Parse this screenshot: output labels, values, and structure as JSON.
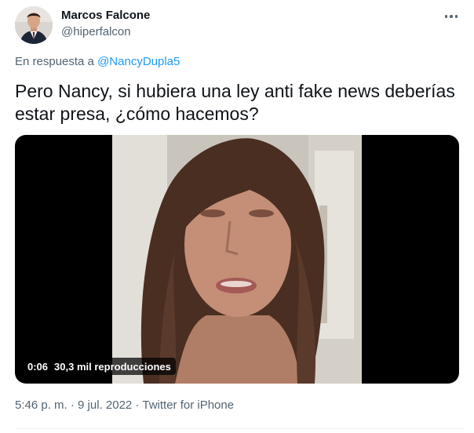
{
  "author": {
    "name": "Marcos Falcone",
    "handle": "@hiperfalcon"
  },
  "reply": {
    "prefix": "En respuesta a",
    "mention": "@NancyDupla5"
  },
  "tweet": {
    "text": "Pero Nancy, si hubiera una ley anti fake news deberías estar presa, ¿cómo hacemos?"
  },
  "video": {
    "duration": "0:06",
    "views": "30,3 mil reproducciones"
  },
  "meta": {
    "time": "5:46 p. m.",
    "separator1": "·",
    "date": "9 jul. 2022",
    "separator2": "·",
    "source": "Twitter for iPhone"
  },
  "colors": {
    "link": "#1d9bf0",
    "secondary_text": "#536471",
    "primary_text": "#0f1419"
  },
  "icons": {
    "more": "more-dots-icon"
  }
}
